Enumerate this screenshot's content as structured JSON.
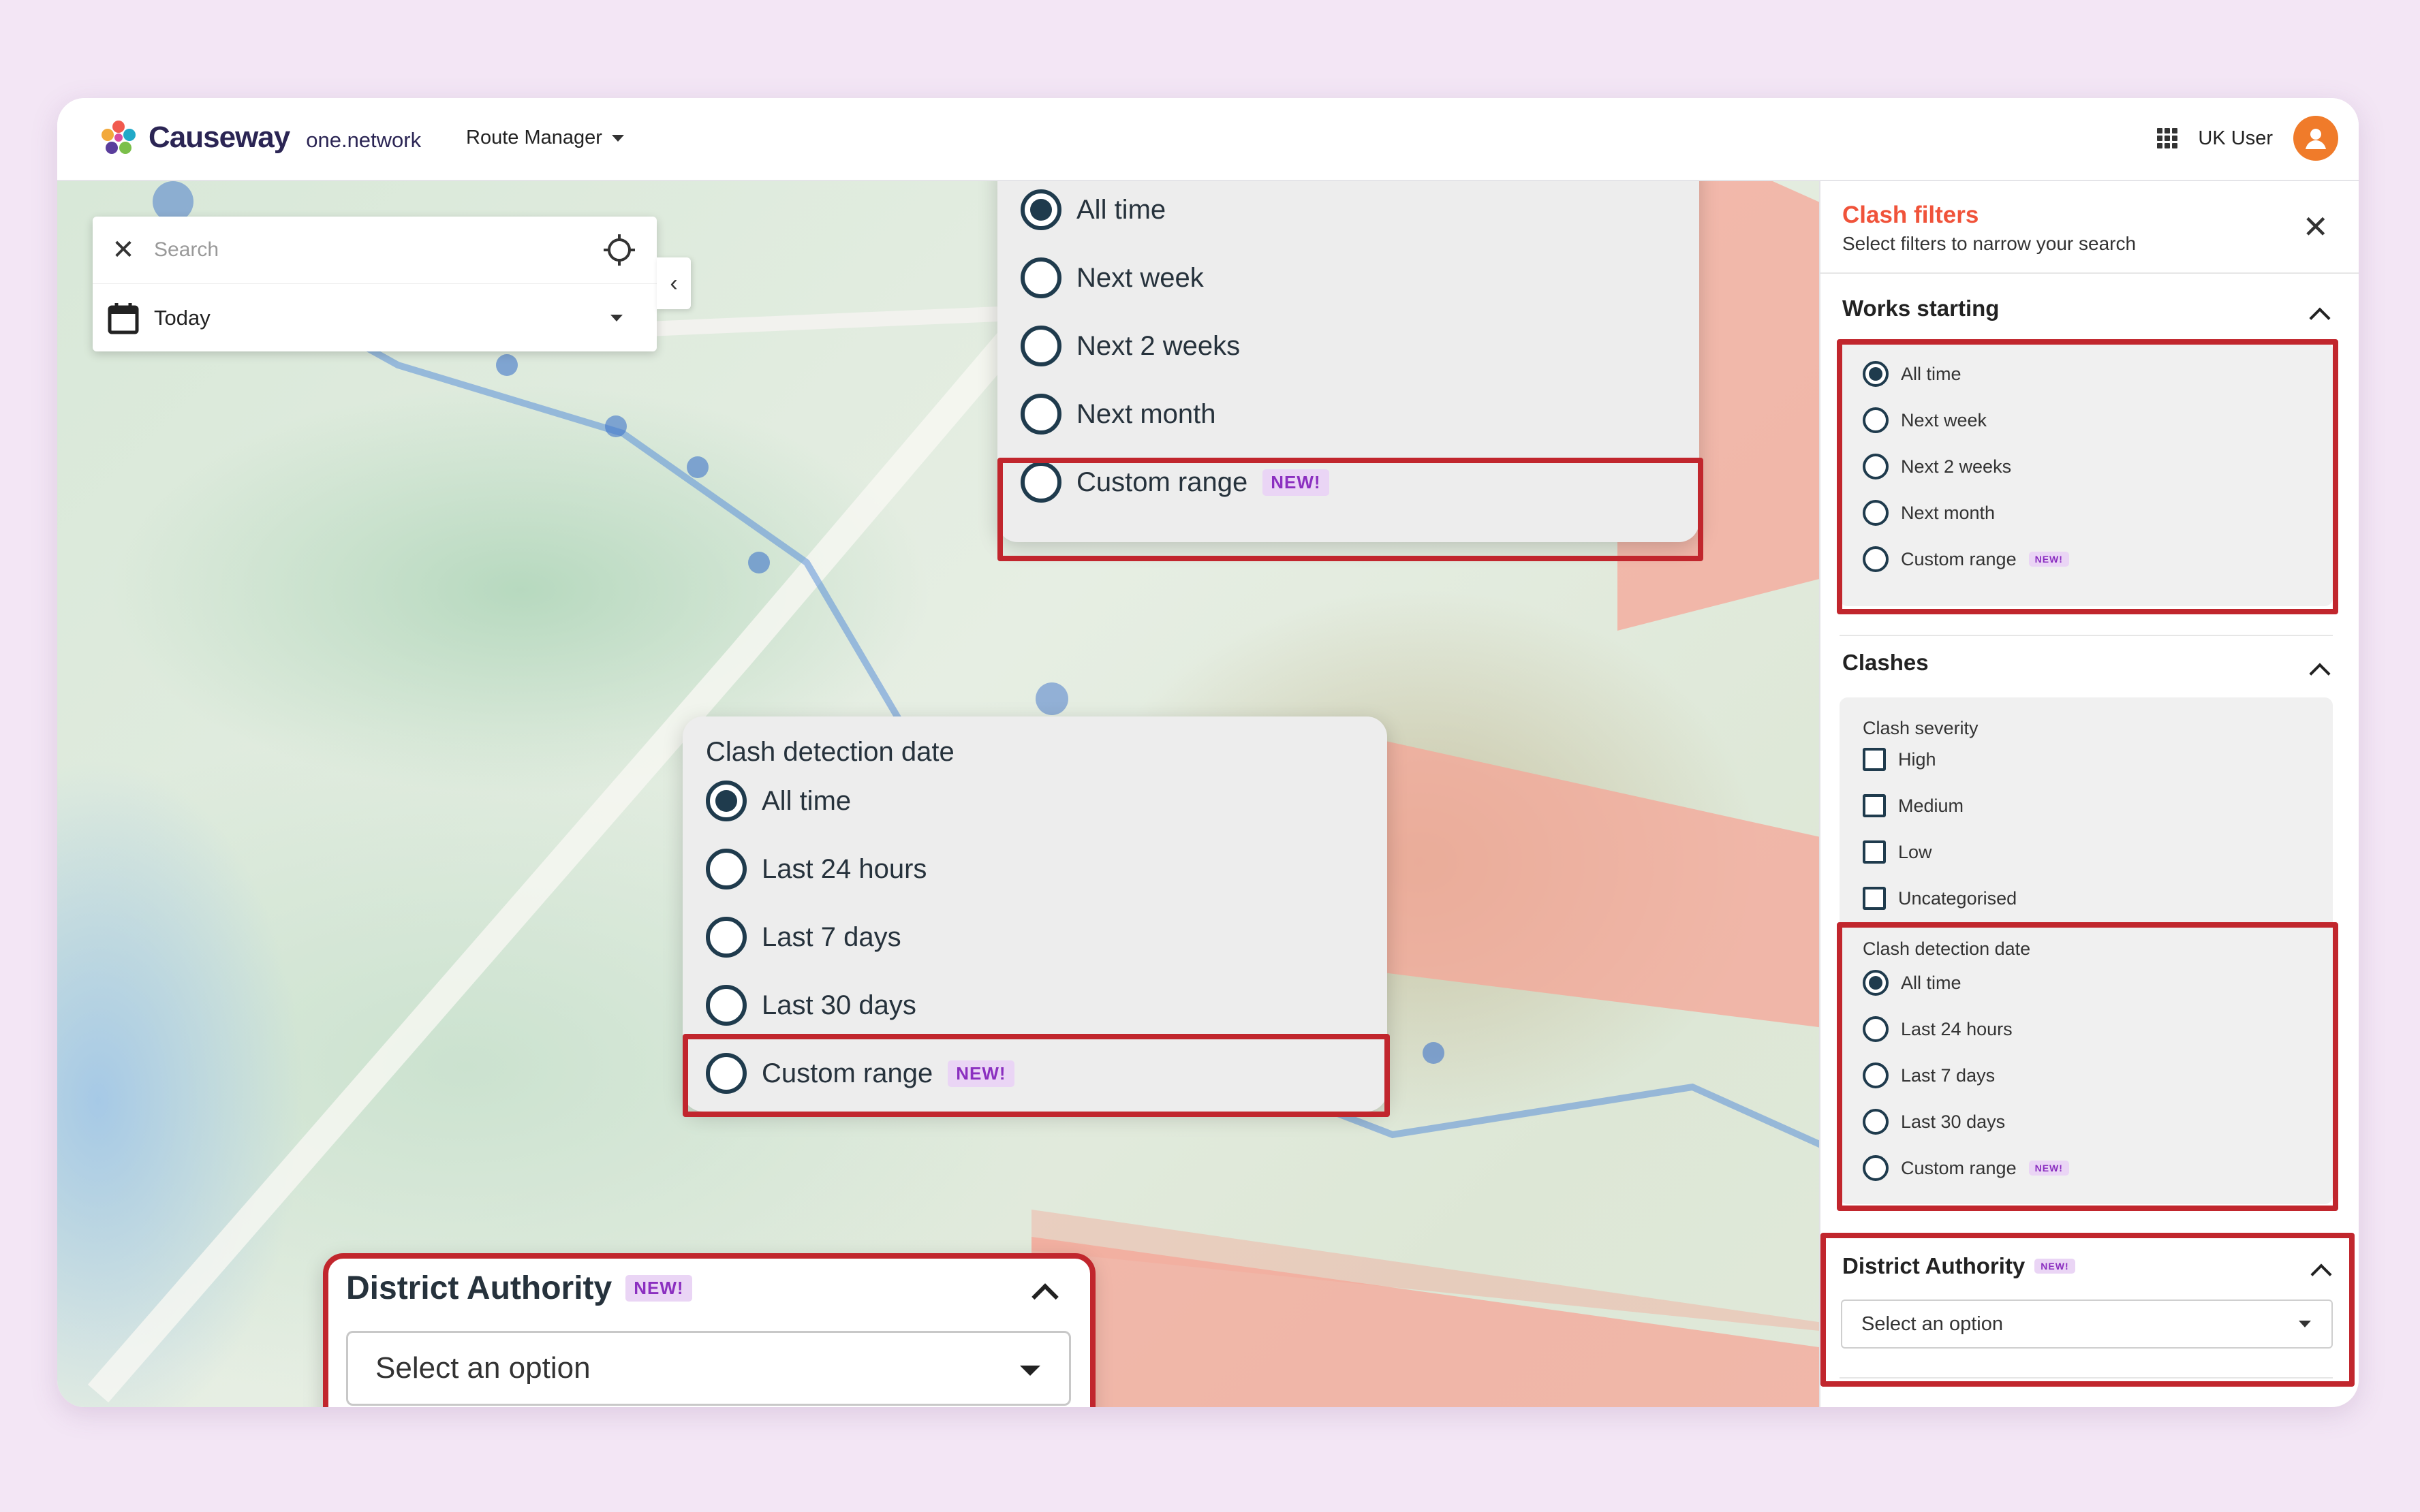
{
  "header": {
    "brand": "Causeway",
    "brand_sub": "one.network",
    "nav_label": "Route Manager",
    "user_name": "UK User"
  },
  "search": {
    "placeholder": "Search",
    "date_value": "Today"
  },
  "sidebar": {
    "title": "Clash filters",
    "subtitle": "Select filters to narrow your search",
    "works_starting": {
      "heading": "Works starting",
      "options": [
        "All time",
        "Next week",
        "Next 2 weeks",
        "Next month",
        "Custom range"
      ],
      "selected": 0
    },
    "clashes": {
      "heading": "Clashes",
      "severity_label": "Clash severity",
      "severity_options": [
        "High",
        "Medium",
        "Low",
        "Uncategorised"
      ],
      "date_label": "Clash detection date",
      "date_options": [
        "All time",
        "Last 24 hours",
        "Last 7 days",
        "Last 30 days",
        "Custom range"
      ],
      "date_selected": 0
    },
    "district": {
      "heading": "District Authority",
      "placeholder": "Select an option"
    },
    "new_badge": "NEW!"
  },
  "callouts": {
    "works": {
      "options": [
        "All time",
        "Next week",
        "Next 2 weeks",
        "Next month",
        "Custom range"
      ]
    },
    "clash_date": {
      "label": "Clash detection date",
      "options": [
        "All time",
        "Last 24 hours",
        "Last 7 days",
        "Last 30 days",
        "Custom range"
      ]
    },
    "district": {
      "heading": "District Authority",
      "placeholder": "Select an option"
    }
  },
  "colors": {
    "accent": "#f0533a",
    "highlight": "#c1262d",
    "new_badge_bg": "#ead5f5",
    "new_badge_text": "#8b2fc0",
    "background": "#f3e6f5"
  }
}
